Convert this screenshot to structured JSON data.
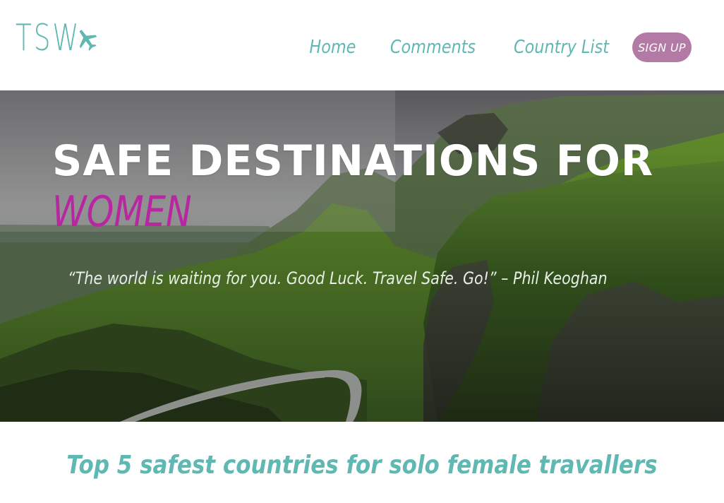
{
  "header": {
    "logo_text": "TSW",
    "logo_icon": "airplane-icon",
    "nav": {
      "home": "Home",
      "comments": "Comments",
      "country_list": "Country List"
    },
    "signup_label": "SIGN UP"
  },
  "hero": {
    "title": "SAFE DESTINATIONS FOR",
    "accent": "WOMEN",
    "quote": "“The world is waiting for you. Good Luck. Travel Safe. Go!” – Phil Keoghan"
  },
  "main": {
    "heading": "Top 5 safest countries for solo female travallers"
  },
  "colors": {
    "teal": "#5fb8b2",
    "signup_bg": "#b27aa4",
    "accent_magenta": "#b727a0"
  }
}
